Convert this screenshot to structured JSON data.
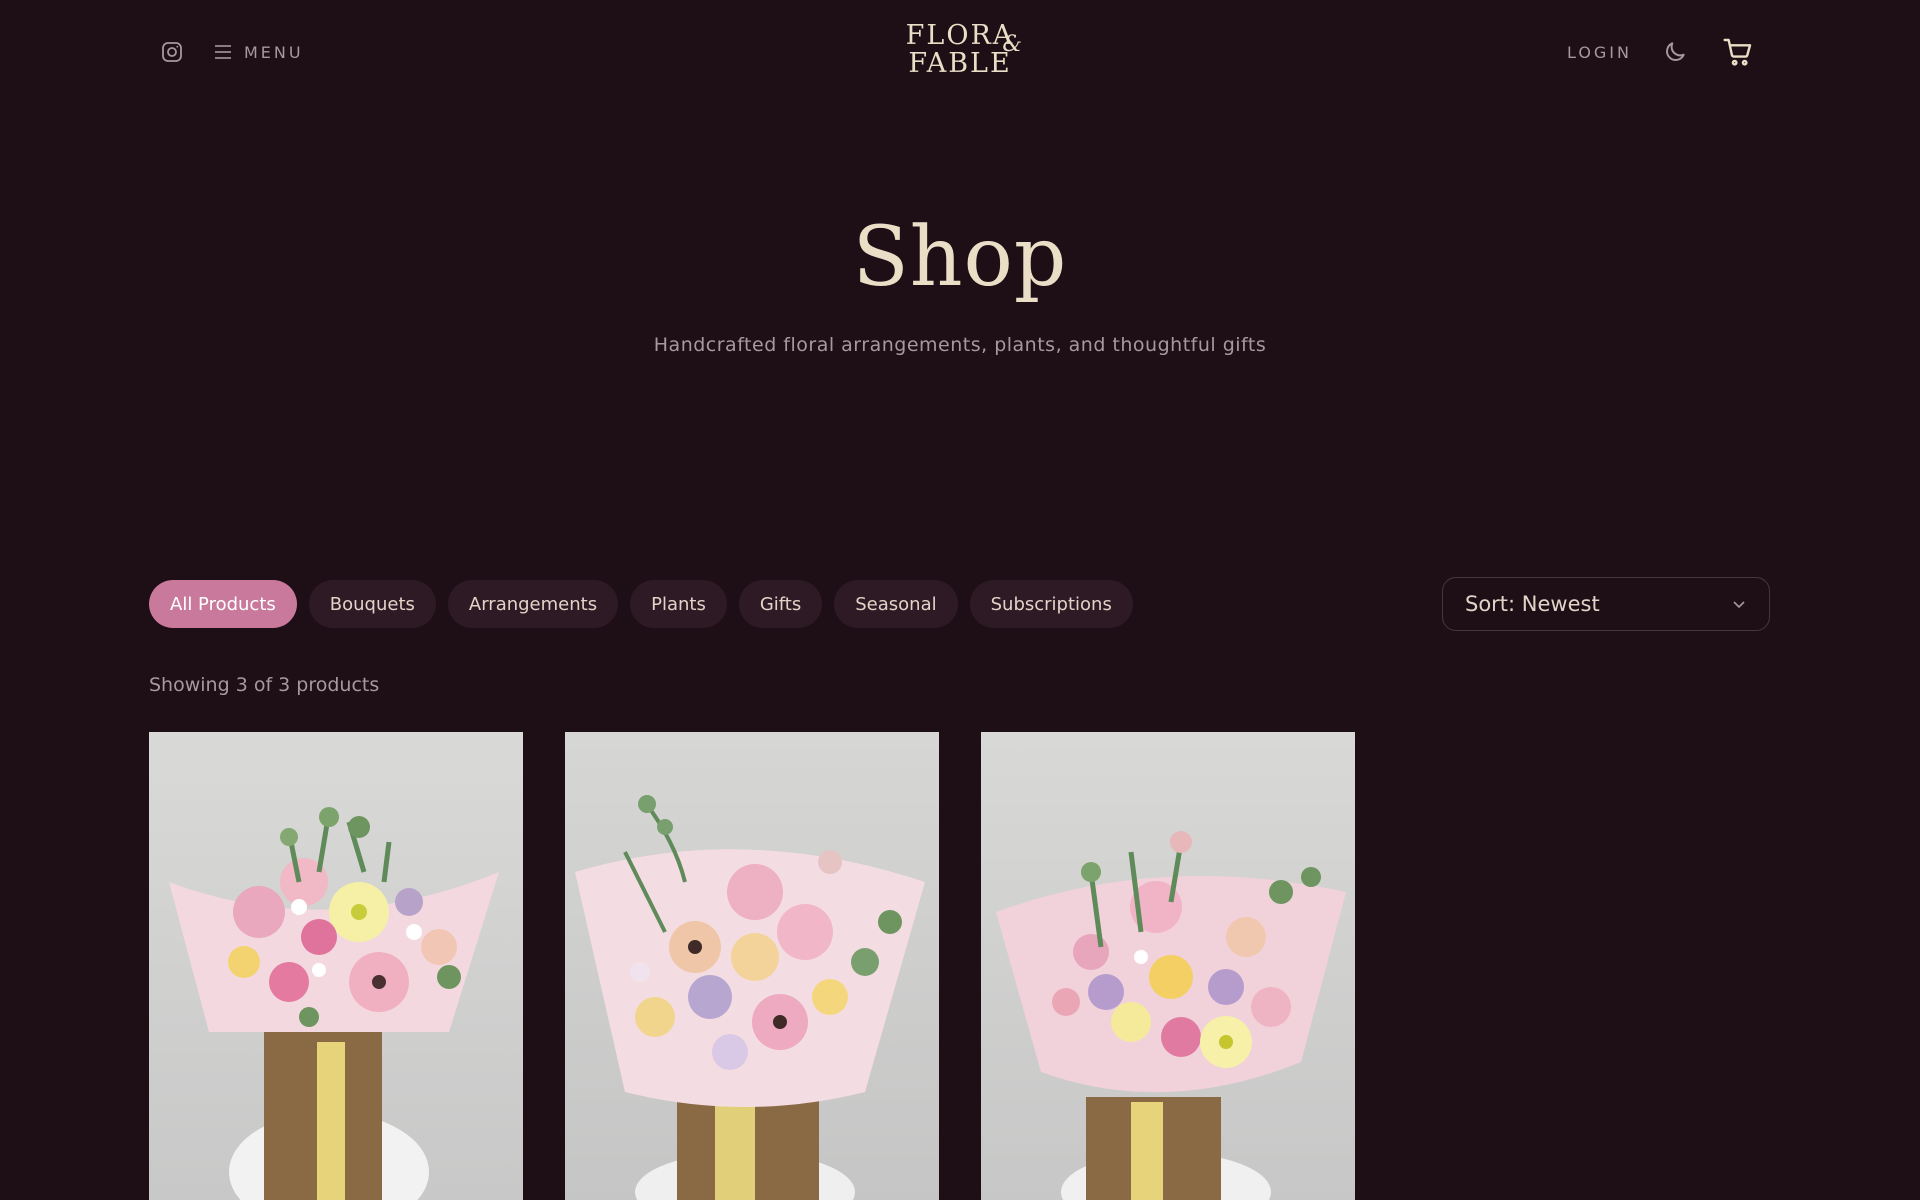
{
  "header": {
    "menu_label": "MENU",
    "logo": {
      "line1": "FLORA",
      "amp": "&",
      "line2": "FABLE"
    },
    "login_label": "LOGIN",
    "icons": {
      "instagram": "instagram-icon",
      "menu": "hamburger-icon",
      "theme": "moon-icon",
      "cart": "cart-icon"
    }
  },
  "hero": {
    "title": "Shop",
    "subtitle": "Handcrafted floral arrangements, plants, and thoughtful gifts"
  },
  "filters": {
    "chips": [
      "All Products",
      "Bouquets",
      "Arrangements",
      "Plants",
      "Gifts",
      "Seasonal",
      "Subscriptions"
    ],
    "active": "All Products"
  },
  "sort": {
    "label": "Sort: Newest"
  },
  "results": {
    "count_text": "Showing 3 of 3 products"
  },
  "products": [
    {
      "image": "pastel bouquet in kraft box with yellow ribbon"
    },
    {
      "image": "lavender and peach bouquet in pink wrap"
    },
    {
      "image": "pink and yellow rose bouquet with eucalyptus"
    }
  ],
  "colors": {
    "background": "#1e0f17",
    "accent": "#c9799b",
    "chip": "#2d1a24",
    "title": "#eadfc6",
    "muted": "#a8979e"
  }
}
